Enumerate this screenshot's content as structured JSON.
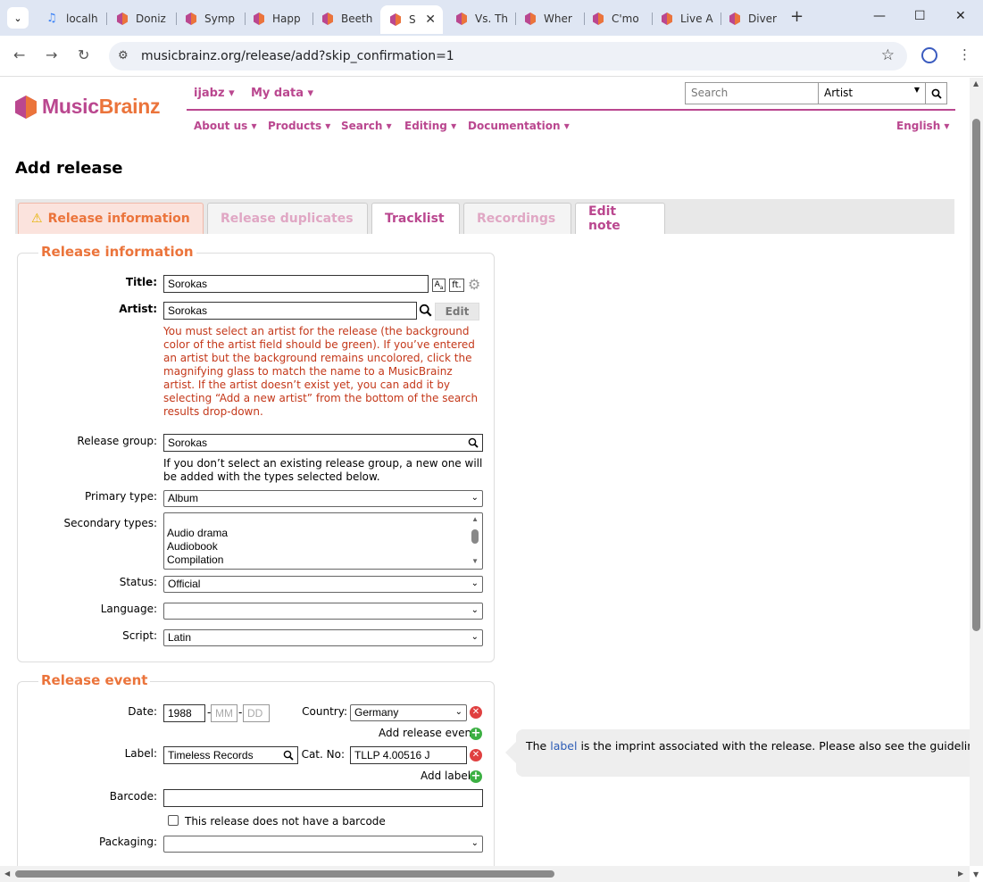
{
  "browser": {
    "tabs": [
      {
        "label": "localh",
        "active": false
      },
      {
        "label": "Doniz",
        "active": false
      },
      {
        "label": "Symp",
        "active": false
      },
      {
        "label": "Happ",
        "active": false
      },
      {
        "label": "Beeth",
        "active": false
      },
      {
        "label": "S",
        "active": true
      },
      {
        "label": "Vs. Th",
        "active": false
      },
      {
        "label": "Wher",
        "active": false
      },
      {
        "label": "C'mo",
        "active": false
      },
      {
        "label": "Live A",
        "active": false
      },
      {
        "label": "Diver",
        "active": false
      }
    ],
    "url": "musicbrainz.org/release/add?skip_confirmation=1"
  },
  "header": {
    "logo_part1": "Music",
    "logo_part2": "Brainz",
    "user": "ijabz",
    "my_data": "My data",
    "search_placeholder": "Search",
    "search_type": "Artist",
    "menu": [
      "About us",
      "Products",
      "Search",
      "Editing",
      "Documentation"
    ],
    "language": "English"
  },
  "page_title": "Add release",
  "tabs": {
    "release_information": "Release information",
    "release_duplicates": "Release duplicates",
    "tracklist": "Tracklist",
    "recordings": "Recordings",
    "edit_note": "Edit note"
  },
  "release_info": {
    "legend": "Release information",
    "title_label": "Title:",
    "title_value": "Sorokas",
    "artist_label": "Artist:",
    "artist_value": "Sorokas",
    "edit_button": "Edit",
    "artist_error": "You must select an artist for the release (the background color of the artist field should be green). If you’ve entered an artist but the background remains uncolored, click the magnifying glass to match the name to a MusicBrainz artist. If the artist doesn’t exist yet, you can add it by selecting “Add a new artist” from the bottom of the search results drop-down.",
    "release_group_label": "Release group:",
    "release_group_value": "Sorokas",
    "release_group_note": "If you don’t select an existing release group, a new one will be added with the types selected below.",
    "primary_type_label": "Primary type:",
    "primary_type_value": "Album",
    "secondary_types_label": "Secondary types:",
    "secondary_types_options": [
      "Audio drama",
      "Audiobook",
      "Compilation"
    ],
    "status_label": "Status:",
    "status_value": "Official",
    "language_label": "Language:",
    "language_value": "",
    "script_label": "Script:",
    "script_value": "Latin"
  },
  "release_event": {
    "legend": "Release event",
    "date_label": "Date:",
    "year": "1988",
    "month_placeholder": "MM",
    "day_placeholder": "DD",
    "country_label": "Country:",
    "country_value": "Germany",
    "add_release_event": "Add release event",
    "label_label": "Label:",
    "label_value": "Timeless Records",
    "catno_label": "Cat. No:",
    "catno_value": "TLLP 4.00516 J",
    "add_label": "Add label",
    "barcode_label": "Barcode:",
    "barcode_value": "",
    "no_barcode_text": "This release does not have a barcode",
    "packaging_label": "Packaging:",
    "packaging_value": ""
  },
  "tooltip": {
    "prefix": "The ",
    "link": "label",
    "suffix": " is the imprint associated with the release. Please also see the guidelines"
  },
  "colors": {
    "orange": "#eb743b",
    "purple": "#ba478f",
    "error_red": "#c4381a"
  }
}
